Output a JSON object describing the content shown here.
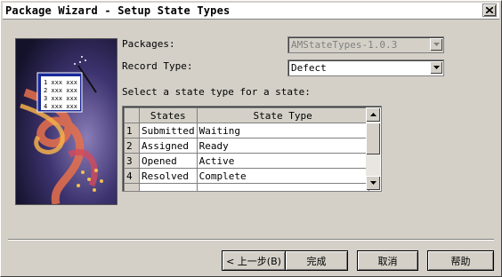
{
  "window": {
    "title": "Package Wizard - Setup State Types"
  },
  "form": {
    "packages_label": "Packages:",
    "packages_value": "AMStateTypes-1.0.3",
    "record_type_label": "Record Type:",
    "record_type_value": "Defect",
    "instruction": "Select a state type for a state:"
  },
  "grid": {
    "headers": [
      "States",
      "State Type"
    ],
    "rows": [
      {
        "num": "1",
        "state": "Submitted",
        "type": "Waiting"
      },
      {
        "num": "2",
        "state": "Assigned",
        "type": "Ready"
      },
      {
        "num": "3",
        "state": "Opened",
        "type": "Active"
      },
      {
        "num": "4",
        "state": "Resolved",
        "type": "Complete"
      }
    ]
  },
  "buttons": {
    "back": "< 上一步(B)",
    "finish": "完成",
    "cancel": "取消",
    "help": "帮助"
  },
  "art": {
    "list_items": [
      "1 xxx xxx",
      "2 xxx xxx",
      "3 xxx xxx",
      "4 xxx xxx"
    ]
  }
}
